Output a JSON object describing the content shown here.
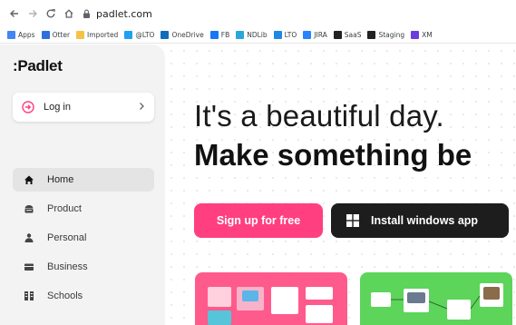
{
  "browser": {
    "url": "padlet.com",
    "bookmarks": [
      {
        "label": "Apps",
        "color": "#4285f4"
      },
      {
        "label": "Otter",
        "color": "#2f6fe0"
      },
      {
        "label": "Imported",
        "color": "#f5c242"
      },
      {
        "label": "@LTO",
        "color": "#1da1f2"
      },
      {
        "label": "OneDrive",
        "color": "#0f6cbd"
      },
      {
        "label": "FB",
        "color": "#1877f2"
      },
      {
        "label": "NDLib",
        "color": "#2aa7d8"
      },
      {
        "label": "LTO",
        "color": "#1e88e5"
      },
      {
        "label": "JIRA",
        "color": "#2684ff"
      },
      {
        "label": "SaaS",
        "color": "#222222"
      },
      {
        "label": "Staging",
        "color": "#222222"
      },
      {
        "label": "XM",
        "color": "#6c3de0"
      }
    ]
  },
  "sidebar": {
    "logo": ":Padlet",
    "login_label": "Log in",
    "items": [
      {
        "label": "Home",
        "icon": "home-icon"
      },
      {
        "label": "Product",
        "icon": "product-icon"
      },
      {
        "label": "Personal",
        "icon": "personal-icon"
      },
      {
        "label": "Business",
        "icon": "business-icon"
      },
      {
        "label": "Schools",
        "icon": "schools-icon"
      }
    ]
  },
  "hero": {
    "line1": "It's a beautiful day.",
    "line2": "Make something be",
    "signup_label": "Sign up for free",
    "install_label": "Install windows app"
  },
  "colors": {
    "accent_pink": "#ff3f7f",
    "dark_button": "#1d1d1d",
    "card_pink": "#ff5a8c",
    "card_green": "#5cd55a"
  }
}
